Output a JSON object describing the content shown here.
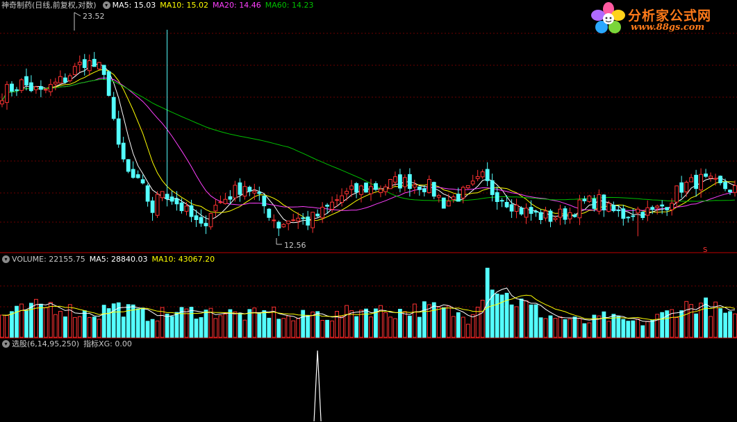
{
  "colors": {
    "background": "#000000",
    "grid": "#6e0000",
    "divider": "#c00000",
    "up": "#ff3232",
    "down": "#54ffff",
    "ma5": "#ffffff",
    "ma10": "#ffff00",
    "ma20": "#ff40ff",
    "ma60": "#00c000",
    "label": "#c8c8c8",
    "xg_line": "#ffffff",
    "logo_orange": "#ff7a1a"
  },
  "price_panel": {
    "name": "神奇制药(日线,前复权,对数)",
    "control_icon": "chevron-down-icon",
    "ma": [
      {
        "label": "MA5: 15.03",
        "color": "#ffffff"
      },
      {
        "label": "MA10: 15.02",
        "color": "#ffff00"
      },
      {
        "label": "MA20: 14.46",
        "color": "#ff40ff"
      },
      {
        "label": "MA60: 14.23",
        "color": "#00c000"
      }
    ],
    "high_label": "23.52",
    "low_label": "12.56",
    "marker": "S"
  },
  "volume_panel": {
    "control_icon": "chevron-down-icon",
    "labels": [
      {
        "label": "VOLUME: 22155.75",
        "color": "#c8c8c8"
      },
      {
        "label": "MA5: 28840.03",
        "color": "#ffffff"
      },
      {
        "label": "MA10: 43067.20",
        "color": "#ffff00"
      }
    ]
  },
  "indicator_panel": {
    "control_icon": "chevron-down-icon",
    "labels": [
      {
        "label": "选股(6,14,95,250)",
        "color": "#c8c8c8"
      },
      {
        "label": "指标XG: 0.00",
        "color": "#c8c8c8"
      }
    ]
  },
  "logo": {
    "text": "分析家公式网",
    "url": "www.88gs.com",
    "icon": "flower-logo-icon"
  },
  "chart_data": [
    {
      "type": "candlestick",
      "title": "神奇制药(日线,前复权,对数)",
      "scale": "log",
      "ylim": [
        12.0,
        25.0
      ],
      "grid": true,
      "anchors": [
        [
          0,
          19.4
        ],
        [
          4,
          20.0
        ],
        [
          8,
          19.4
        ],
        [
          13,
          20.3
        ],
        [
          17,
          21.4
        ],
        [
          20,
          20.9
        ],
        [
          22,
          19.6
        ],
        [
          24,
          16.3
        ],
        [
          26,
          15.2
        ],
        [
          29,
          14.5
        ],
        [
          31,
          13.6
        ],
        [
          33,
          14.5
        ],
        [
          36,
          13.9
        ],
        [
          39,
          13.3
        ],
        [
          41,
          12.85
        ],
        [
          43,
          13.6
        ],
        [
          46,
          14.1
        ],
        [
          50,
          14.7
        ],
        [
          52,
          14.3
        ],
        [
          55,
          13.5
        ],
        [
          57,
          13.0
        ],
        [
          60,
          13.3
        ],
        [
          63,
          13.15
        ],
        [
          66,
          13.5
        ],
        [
          70,
          14.2
        ],
        [
          74,
          14.5
        ],
        [
          78,
          14.6
        ],
        [
          81,
          14.8
        ],
        [
          84,
          14.8
        ],
        [
          88,
          14.6
        ],
        [
          91,
          13.9
        ],
        [
          94,
          14.2
        ],
        [
          96,
          14.4
        ],
        [
          99,
          15.0
        ],
        [
          101,
          14.4
        ],
        [
          104,
          14.0
        ],
        [
          107,
          13.6
        ],
        [
          110,
          13.4
        ],
        [
          113,
          13.3
        ],
        [
          117,
          13.5
        ],
        [
          120,
          13.9
        ],
        [
          123,
          14.0
        ],
        [
          125,
          13.6
        ],
        [
          128,
          13.4
        ],
        [
          131,
          13.6
        ],
        [
          134,
          13.5
        ],
        [
          137,
          13.9
        ],
        [
          140,
          14.6
        ],
        [
          144,
          14.9
        ],
        [
          148,
          14.6
        ],
        [
          151,
          14.5
        ]
      ],
      "ma_periods": [
        5,
        10,
        20,
        60
      ],
      "annotations": [
        {
          "text": "23.52",
          "value": 23.52
        },
        {
          "text": "12.56",
          "value": 12.56
        }
      ]
    },
    {
      "type": "bar",
      "title": "VOLUME",
      "anchors": [
        [
          0,
          30
        ],
        [
          5,
          38
        ],
        [
          10,
          45
        ],
        [
          16,
          34
        ],
        [
          20,
          32
        ],
        [
          22,
          45
        ],
        [
          26,
          38
        ],
        [
          30,
          30
        ],
        [
          36,
          34
        ],
        [
          40,
          36
        ],
        [
          46,
          34
        ],
        [
          50,
          30
        ],
        [
          56,
          34
        ],
        [
          60,
          24
        ],
        [
          64,
          34
        ],
        [
          68,
          28
        ],
        [
          72,
          36
        ],
        [
          76,
          40
        ],
        [
          80,
          34
        ],
        [
          84,
          38
        ],
        [
          88,
          40
        ],
        [
          92,
          36
        ],
        [
          96,
          26
        ],
        [
          99,
          70
        ],
        [
          100,
          95
        ],
        [
          101,
          85
        ],
        [
          102,
          72
        ],
        [
          104,
          56
        ],
        [
          108,
          44
        ],
        [
          112,
          30
        ],
        [
          116,
          26
        ],
        [
          120,
          20
        ],
        [
          124,
          28
        ],
        [
          128,
          22
        ],
        [
          132,
          20
        ],
        [
          136,
          30
        ],
        [
          140,
          42
        ],
        [
          144,
          46
        ],
        [
          148,
          36
        ],
        [
          151,
          26
        ]
      ],
      "ma_periods": [
        5,
        10
      ]
    },
    {
      "type": "line",
      "title": "指标XG",
      "values_note": "",
      "spikes": [
        {
          "index": 65,
          "value": 1
        }
      ]
    }
  ]
}
